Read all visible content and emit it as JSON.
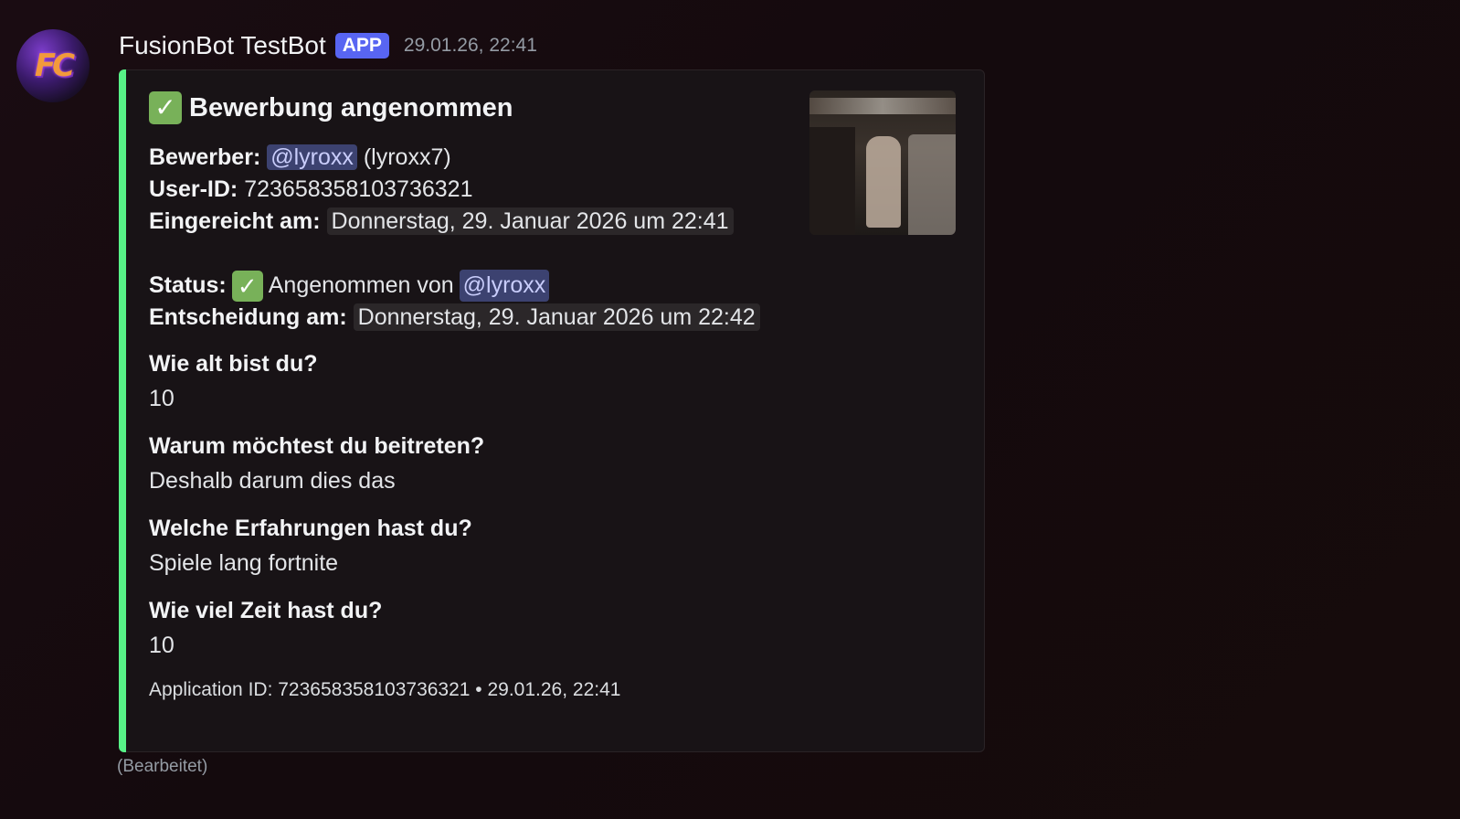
{
  "message": {
    "author": "FusionBot TestBot",
    "badge": "APP",
    "timestamp": "29.01.26, 22:41",
    "edited": "(Bearbeitet)"
  },
  "avatar": {
    "letters": "FC"
  },
  "embed": {
    "accent_color": "#57f287",
    "title": "Bewerbung angenommen",
    "title_icon": "check-mark-button-icon",
    "applicant_label": "Bewerber:",
    "applicant_mention": "@lyroxx",
    "applicant_username": "(lyroxx7)",
    "user_id_label": "User-ID:",
    "user_id": "723658358103736321",
    "submitted_label": "Eingereicht am:",
    "submitted_at": "Donnerstag, 29. Januar 2026 um 22:41",
    "status_label": "Status:",
    "status_text": "Angenommen von",
    "status_mention": "@lyroxx",
    "decision_label": "Entscheidung am:",
    "decision_at": "Donnerstag, 29. Januar 2026 um 22:42",
    "fields": [
      {
        "name": "Wie alt bist du?",
        "value": "10"
      },
      {
        "name": "Warum möchtest du beitreten?",
        "value": "Deshalb darum dies das"
      },
      {
        "name": "Welche Erfahrungen hast du?",
        "value": "Spiele lang fortnite"
      },
      {
        "name": "Wie viel Zeit hast du?",
        "value": "10"
      }
    ],
    "footer": "Application ID: 723658358103736321 • 29.01.26, 22:41"
  }
}
